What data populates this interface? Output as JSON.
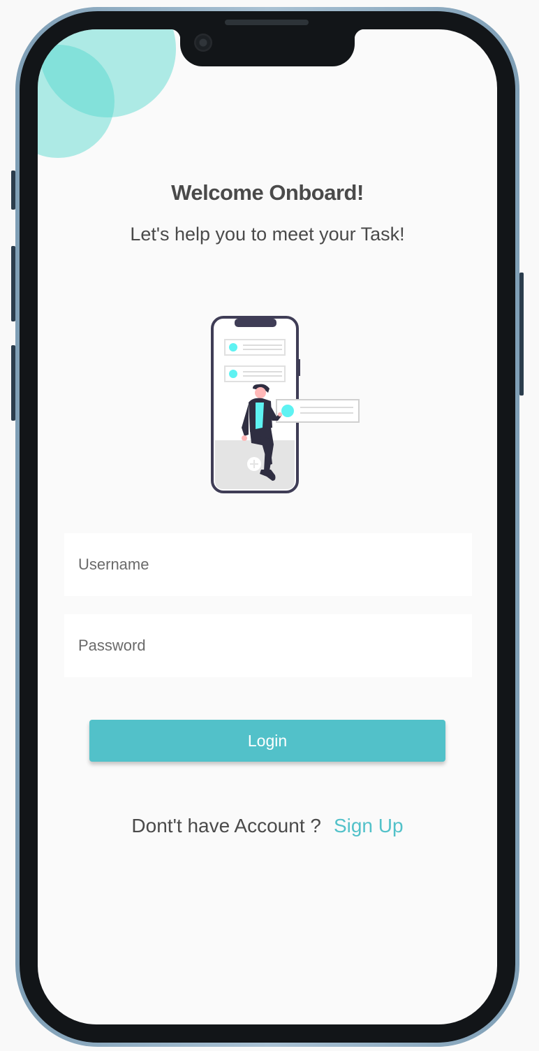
{
  "welcome": {
    "title": "Welcome Onboard!",
    "subtitle": "Let's help you to meet your Task!"
  },
  "form": {
    "username_placeholder": "Username",
    "username_value": "",
    "password_placeholder": "Password",
    "password_value": "",
    "login_label": "Login"
  },
  "signup": {
    "prompt": "Dont't have Account ?",
    "link_label": "Sign Up"
  },
  "icons": [
    "camera-icon",
    "onboarding-illustration"
  ],
  "colors": {
    "accent": "#52c1c9",
    "blob": "#50d7cd",
    "title_text": "#4a4a4a",
    "screen_background": "#fafafa",
    "device_frame": "#8fb0c6"
  }
}
